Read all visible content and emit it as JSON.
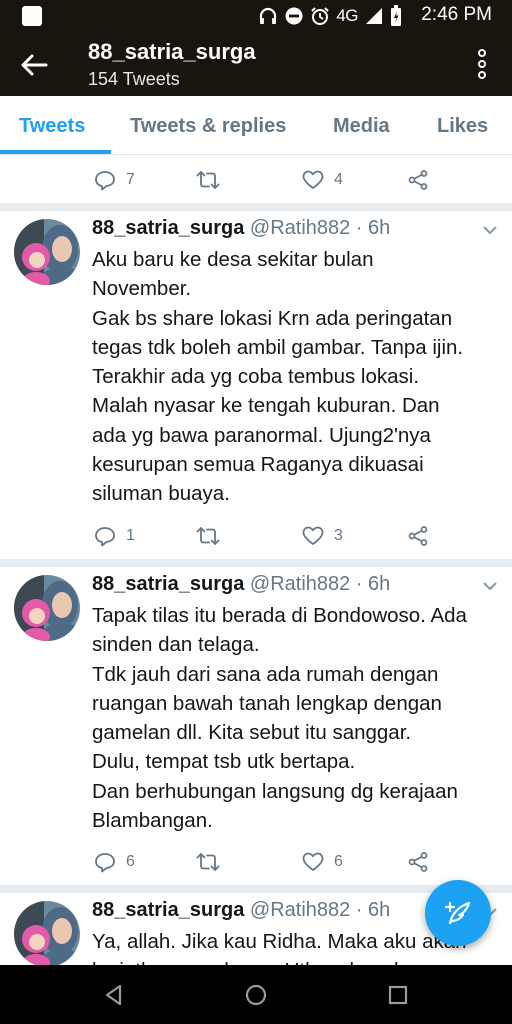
{
  "status_bar": {
    "time": "2:46 PM",
    "network": "4G",
    "icons": [
      "notification-box-icon",
      "headphones-icon",
      "do-not-disturb-icon",
      "alarm-icon",
      "signal-icon",
      "battery-icon"
    ]
  },
  "header": {
    "title": "88_satria_surga",
    "subtitle": "154 Tweets"
  },
  "tabs": [
    {
      "label": "Tweets",
      "active": true
    },
    {
      "label": "Tweets & replies",
      "active": false
    },
    {
      "label": "Media",
      "active": false
    },
    {
      "label": "Likes",
      "active": false
    }
  ],
  "partial_tweet": {
    "replies": "7",
    "retweets": "",
    "likes": "4"
  },
  "tweets": [
    {
      "name": "88_satria_surga",
      "handle": "@Ratih882 · 6h",
      "lines": [
        "Aku baru ke desa sekitar bulan",
        "November.",
        "Gak bs share lokasi Krn ada peringatan",
        "tegas tdk boleh ambil gambar. Tanpa ijin.",
        "Terakhir ada yg coba tembus lokasi.",
        "Malah nyasar ke tengah kuburan. Dan",
        "ada yg bawa paranormal. Ujung2'nya",
        "kesurupan semua Raganya dikuasai",
        "siluman buaya."
      ],
      "replies": "1",
      "retweets": "",
      "likes": "3"
    },
    {
      "name": "88_satria_surga",
      "handle": "@Ratih882 · 6h",
      "lines": [
        "Tapak tilas itu berada di Bondowoso. Ada",
        "sinden dan telaga.",
        "Tdk jauh dari sana ada rumah dengan",
        "ruangan bawah tanah lengkap dengan",
        "gamelan dll. Kita sebut itu sanggar.",
        "Dulu, tempat tsb utk bertapa.",
        "Dan berhubungan langsung dg kerajaan",
        "Blambangan."
      ],
      "replies": "6",
      "retweets": "",
      "likes": "6"
    },
    {
      "name": "88_satria_surga",
      "handle": "@Ratih882 · 6h",
      "lines": [
        "Ya, allah. Jika kau Ridha. Maka aku akan",
        "lanjutkan segalanya. Utk meluruskan"
      ]
    }
  ],
  "colors": {
    "accent": "#1da1f2",
    "header_bg": "#1a140f",
    "muted_text": "#657786",
    "divider": "#e6ecf0"
  }
}
